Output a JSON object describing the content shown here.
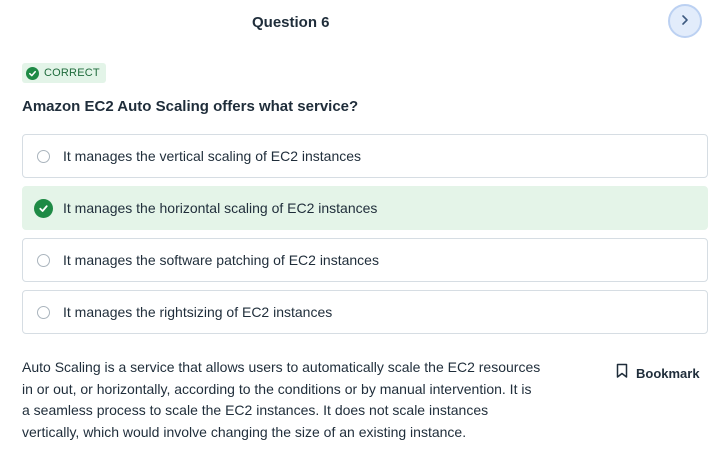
{
  "header": {
    "title": "Question 6",
    "next_icon": "chevron-right-icon"
  },
  "status": {
    "label": "CORRECT",
    "icon": "check-circle-icon",
    "color": "#1e8a45"
  },
  "question": {
    "text": "Amazon EC2 Auto Scaling offers what service?"
  },
  "options": [
    {
      "text": "It manages the vertical scaling of EC2 instances",
      "selected": false
    },
    {
      "text": "It manages the horizontal scaling of EC2 instances",
      "selected": true
    },
    {
      "text": "It manages the software patching of EC2 instances",
      "selected": false
    },
    {
      "text": "It manages the rightsizing of EC2 instances",
      "selected": false
    }
  ],
  "explanation": {
    "text": "Auto Scaling is a service that allows users to automatically scale the EC2 resources in or out, or horizontally, according to the conditions or by manual intervention. It is a seamless process to scale the EC2 instances. It does not scale instances vertically, which would involve changing the size of an existing instance."
  },
  "bookmark": {
    "label": "Bookmark",
    "icon": "bookmark-icon"
  },
  "colors": {
    "correct_bg": "#e4f4e8",
    "correct_accent": "#1e8a45",
    "nav_button_bg": "#e2ecfb"
  }
}
